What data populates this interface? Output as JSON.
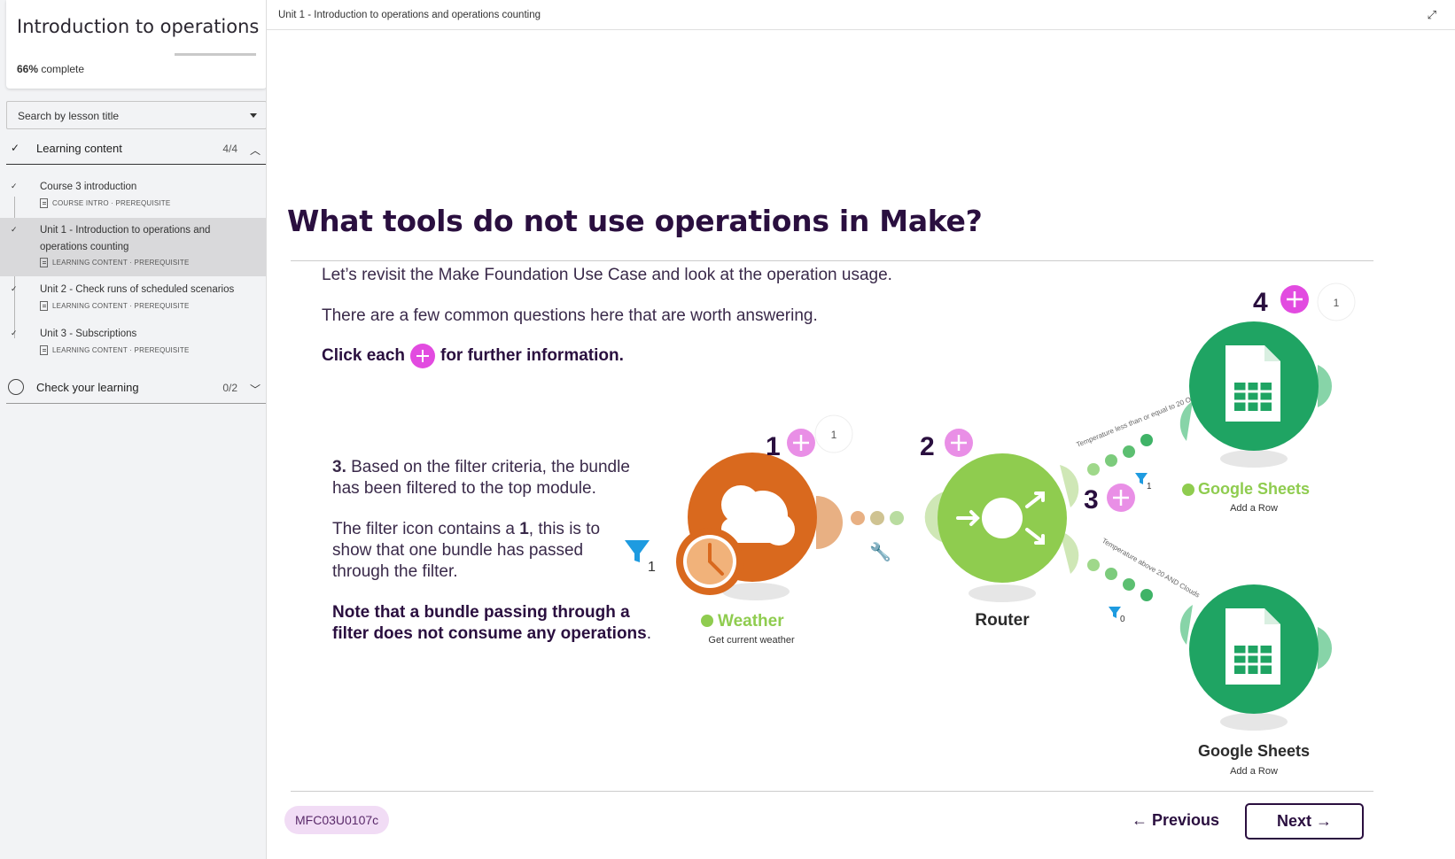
{
  "sidebar": {
    "course_title": "Introduction to operations",
    "progress_percent": "66%",
    "progress_suffix": " complete",
    "search_placeholder": "Search by lesson title",
    "sections": [
      {
        "label": "Learning content",
        "count": "4/4"
      },
      {
        "label": "Check your learning",
        "count": "0/2"
      }
    ],
    "lessons": [
      {
        "title": "Course 3 introduction",
        "meta": "COURSE INTRO · PREREQUISITE"
      },
      {
        "title": "Unit 1 - Introduction to operations and operations counting",
        "meta": "LEARNING CONTENT · PREREQUISITE"
      },
      {
        "title": "Unit 2 - Check runs of scheduled scenarios",
        "meta": "LEARNING CONTENT · PREREQUISITE"
      },
      {
        "title": "Unit 3 - Subscriptions",
        "meta": "LEARNING CONTENT · PREREQUISITE"
      }
    ]
  },
  "main": {
    "breadcrumb": "Unit 1 - Introduction to operations and operations counting",
    "heading": "What tools do not use operations in Make?",
    "intro1": "Let’s revisit the Make Foundation Use Case and look at the operation usage.",
    "intro2": "There are a few common questions here that are worth answering.",
    "click_pre": "Click each",
    "click_post": "for further information.",
    "note": {
      "num": "3.",
      "line1": " Based on the filter criteria, the bundle",
      "line2": "has been filtered to the top module.",
      "line3a": "The filter icon contains a ",
      "line3b": "1",
      "line3c": ", this is to",
      "line4": "show that one bundle has passed",
      "line5": "through the filter.",
      "bold1": "Note that a bundle passing through a",
      "bold2": "filter does not consume any operations",
      "bold2_end": ".",
      "filter_count": "1"
    },
    "diagram": {
      "weather_title": "Weather",
      "weather_sub": "Get current weather",
      "router_title": "Router",
      "sheets_top_title": "Google Sheets",
      "sheets_top_sub": "Add a Row",
      "sheets_bottom_title": "Google Sheets",
      "sheets_bottom_sub": "Add a Row",
      "hotspot_1": "1",
      "hotspot_2": "2",
      "hotspot_3": "3",
      "hotspot_4": "4",
      "bubble_1": "1",
      "bubble_4": "1",
      "filter_top_count": "1",
      "filter_bottom_count": "0",
      "route_top_label": "Temperature less than or equal to 20 OR Rain",
      "route_bottom_label": "Temperature above 20 AND Clouds"
    },
    "code": "MFC03U0107c",
    "prev_label": "Previous",
    "next_label": "Next"
  },
  "colors": {
    "accent": "#e24be0",
    "heading": "#2a0f3f",
    "weather": "#d9691e",
    "router": "#8fcc4f",
    "sheets": "#1fa463"
  }
}
